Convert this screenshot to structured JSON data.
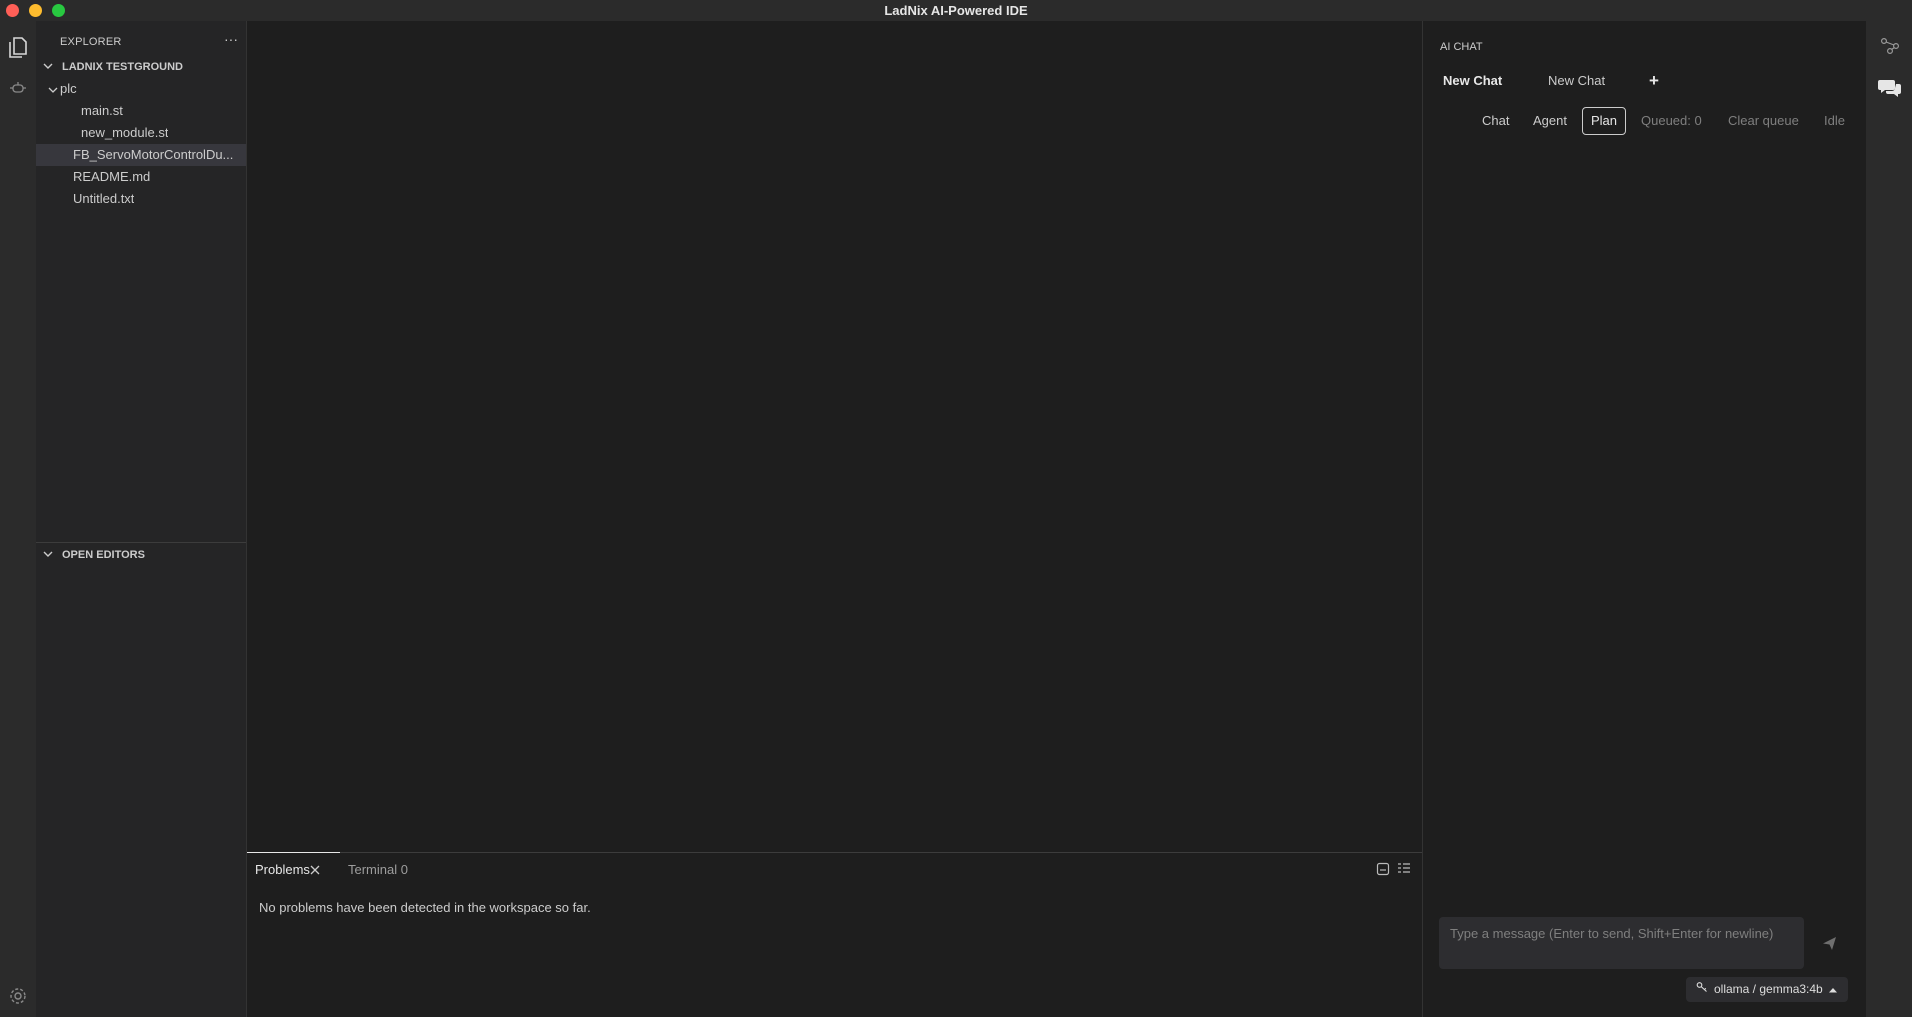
{
  "window": {
    "title": "LadNix AI-Powered IDE"
  },
  "explorer": {
    "title": "EXPLORER",
    "more": "···",
    "workspace": "LADNIX TESTGROUND",
    "tree": [
      {
        "label": "plc",
        "type": "folder"
      },
      {
        "label": "main.st",
        "type": "file"
      },
      {
        "label": "new_module.st",
        "type": "file"
      },
      {
        "label": "FB_ServoMotorControlDu...",
        "type": "file",
        "selected": true
      },
      {
        "label": "README.md",
        "type": "file"
      },
      {
        "label": "Untitled.txt",
        "type": "file"
      }
    ],
    "open_editors": "OPEN EDITORS"
  },
  "panel": {
    "tabs": [
      {
        "label": "Problems",
        "active": true
      },
      {
        "label": "Terminal 0",
        "active": false
      }
    ],
    "message": "No problems have been detected in the workspace so far."
  },
  "chat": {
    "header": "AI CHAT",
    "tabs": [
      {
        "label": "New Chat",
        "active": true
      },
      {
        "label": "New Chat",
        "active": false
      }
    ],
    "add_label": "+",
    "modes": [
      {
        "label": "Chat"
      },
      {
        "label": "Agent"
      },
      {
        "label": "Plan",
        "active": true
      }
    ],
    "queued": "Queued: 0",
    "clear_queue": "Clear queue",
    "status": "Idle",
    "input_placeholder": "Type a message (Enter to send, Shift+Enter for newline)",
    "model": "ollama / gemma3:4b"
  },
  "colors": {
    "accent_border": "#cccccc",
    "selected_bg": "#37373d",
    "traffic_close": "#ff5f57",
    "traffic_min": "#febc2e",
    "traffic_max": "#28c840"
  },
  "icons": {
    "activity_left": [
      "files-icon",
      "debug-icon",
      "settings-icon"
    ],
    "activity_right": [
      "flow-icon",
      "chat-bubbles-icon"
    ]
  }
}
